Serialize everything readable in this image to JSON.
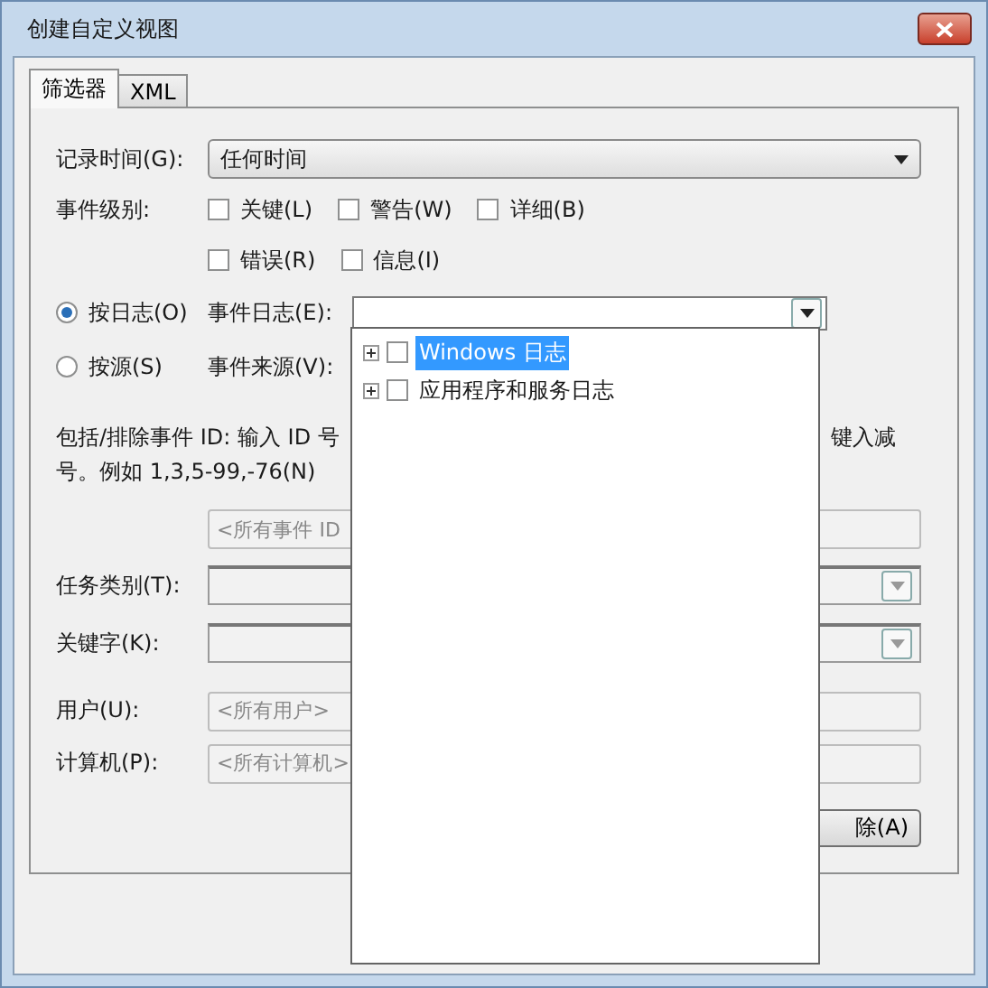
{
  "window": {
    "title": "创建自定义视图"
  },
  "tabs": [
    {
      "label": "筛选器",
      "selected": true
    },
    {
      "label": "XML",
      "selected": false
    }
  ],
  "logged": {
    "label": "记录时间(G):",
    "value": "任何时间"
  },
  "levels": {
    "label": "事件级别:",
    "items": [
      {
        "label": "关键(L)",
        "checked": false
      },
      {
        "label": "警告(W)",
        "checked": false
      },
      {
        "label": "详细(B)",
        "checked": false
      },
      {
        "label": "错误(R)",
        "checked": false
      },
      {
        "label": "信息(I)",
        "checked": false
      }
    ]
  },
  "source_modes": [
    {
      "label": "按日志(O)",
      "selected": true,
      "field_label": "事件日志(E):"
    },
    {
      "label": "按源(S)",
      "selected": false,
      "field_label": "事件来源(V):"
    }
  ],
  "description": {
    "left": "包括/排除事件 ID: 输入 ID 号",
    "right": "键入减",
    "line_2": "号。例如 1,3,5-99,-76(N)"
  },
  "event_id": {
    "placeholder": "<所有事件 ID"
  },
  "fields": [
    {
      "kind": "combo",
      "label": "任务类别(T):"
    },
    {
      "kind": "combo",
      "label": "关键字(K):"
    },
    {
      "kind": "text",
      "label": "用户(U):",
      "placeholder": "<所有用户>"
    },
    {
      "kind": "text",
      "label": "计算机(P):",
      "placeholder": "<所有计算机>"
    }
  ],
  "clear_button": "除(A)",
  "log_tree": [
    {
      "label": "Windows 日志",
      "selected": true,
      "checked": false,
      "expanded": false
    },
    {
      "label": "应用程序和服务日志",
      "selected": false,
      "checked": false,
      "expanded": false
    }
  ]
}
